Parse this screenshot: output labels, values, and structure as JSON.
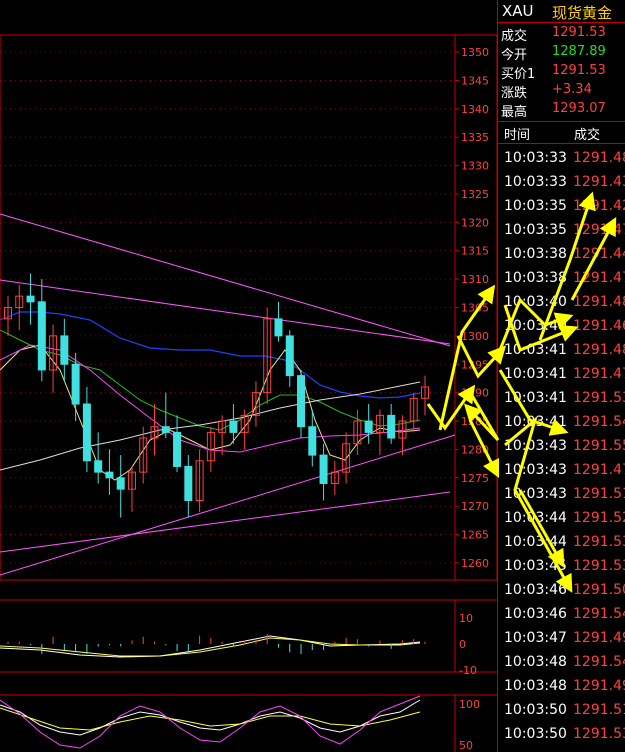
{
  "quote": {
    "symbol": "XAU",
    "name": "现货黄金",
    "rows": [
      {
        "label": "成交",
        "value": "1291.53",
        "color": "red"
      },
      {
        "label": "今开",
        "value": "1287.89",
        "color": "green"
      },
      {
        "label": "买价1",
        "value": "1291.53",
        "color": "red"
      },
      {
        "label": "涨跌",
        "value": "+3.34",
        "color": "red"
      },
      {
        "label": "最高",
        "value": "1293.07",
        "color": "red"
      }
    ]
  },
  "ticks_header": {
    "time": "时间",
    "price": "成交"
  },
  "ticks": [
    {
      "time": "10:03:33",
      "price": "1291.48"
    },
    {
      "time": "10:03:33",
      "price": "1291.43"
    },
    {
      "time": "10:03:35",
      "price": "1291.42"
    },
    {
      "time": "10:03:35",
      "price": "1291.47"
    },
    {
      "time": "10:03:38",
      "price": "1291.44"
    },
    {
      "time": "10:03:38",
      "price": "1291.47"
    },
    {
      "time": "10:03:40",
      "price": "1291.48"
    },
    {
      "time": "10:03:40",
      "price": "1291.46"
    },
    {
      "time": "10:03:41",
      "price": "1291.48"
    },
    {
      "time": "10:03:41",
      "price": "1291.47"
    },
    {
      "time": "10:03:41",
      "price": "1291.53"
    },
    {
      "time": "10:03:41",
      "price": "1291.54"
    },
    {
      "time": "10:03:43",
      "price": "1291.55"
    },
    {
      "time": "10:03:43",
      "price": "1291.47"
    },
    {
      "time": "10:03:43",
      "price": "1291.51"
    },
    {
      "time": "10:03:44",
      "price": "1291.52"
    },
    {
      "time": "10:03:44",
      "price": "1291.53"
    },
    {
      "time": "10:03:45",
      "price": "1291.53"
    },
    {
      "time": "10:03:46",
      "price": "1291.50"
    },
    {
      "time": "10:03:46",
      "price": "1291.54"
    },
    {
      "time": "10:03:47",
      "price": "1291.49"
    },
    {
      "time": "10:03:48",
      "price": "1291.54"
    },
    {
      "time": "10:03:48",
      "price": "1291.49"
    },
    {
      "time": "10:03:50",
      "price": "1291.51"
    },
    {
      "time": "10:03:50",
      "price": "1291.53"
    }
  ],
  "price_axis": {
    "labels": [
      "1350",
      "1345",
      "1340",
      "1335",
      "1330",
      "1325",
      "1320",
      "1315",
      "1310",
      "1305",
      "1300",
      "1295",
      "1290",
      "1285",
      "1280",
      "1275",
      "1270",
      "1265",
      "1260"
    ],
    "ylim": [
      1257,
      1353
    ]
  },
  "macd_axis": {
    "labels": [
      "10",
      "0",
      "-10"
    ]
  },
  "kdj_axis": {
    "labels": [
      "100",
      "50"
    ]
  },
  "candles": [
    {
      "o": 1303,
      "h": 1307,
      "l": 1300,
      "c": 1305
    },
    {
      "o": 1305,
      "h": 1309,
      "l": 1301,
      "c": 1307
    },
    {
      "o": 1307,
      "h": 1311,
      "l": 1302,
      "c": 1306
    },
    {
      "o": 1306,
      "h": 1310,
      "l": 1292,
      "c": 1294
    },
    {
      "o": 1294,
      "h": 1302,
      "l": 1290,
      "c": 1300
    },
    {
      "o": 1300,
      "h": 1303,
      "l": 1292,
      "c": 1295
    },
    {
      "o": 1295,
      "h": 1297,
      "l": 1285,
      "c": 1288
    },
    {
      "o": 1288,
      "h": 1291,
      "l": 1276,
      "c": 1278
    },
    {
      "o": 1278,
      "h": 1283,
      "l": 1274,
      "c": 1276
    },
    {
      "o": 1276,
      "h": 1280,
      "l": 1272,
      "c": 1275
    },
    {
      "o": 1275,
      "h": 1279,
      "l": 1268,
      "c": 1273
    },
    {
      "o": 1273,
      "h": 1277,
      "l": 1269,
      "c": 1276
    },
    {
      "o": 1276,
      "h": 1284,
      "l": 1274,
      "c": 1282
    },
    {
      "o": 1282,
      "h": 1288,
      "l": 1279,
      "c": 1284
    },
    {
      "o": 1284,
      "h": 1290,
      "l": 1282,
      "c": 1283
    },
    {
      "o": 1283,
      "h": 1286,
      "l": 1276,
      "c": 1277
    },
    {
      "o": 1277,
      "h": 1279,
      "l": 1268,
      "c": 1271
    },
    {
      "o": 1271,
      "h": 1280,
      "l": 1269,
      "c": 1278
    },
    {
      "o": 1278,
      "h": 1284,
      "l": 1276,
      "c": 1283
    },
    {
      "o": 1283,
      "h": 1286,
      "l": 1279,
      "c": 1285
    },
    {
      "o": 1285,
      "h": 1288,
      "l": 1281,
      "c": 1283
    },
    {
      "o": 1283,
      "h": 1287,
      "l": 1280,
      "c": 1286
    },
    {
      "o": 1286,
      "h": 1292,
      "l": 1284,
      "c": 1290
    },
    {
      "o": 1290,
      "h": 1305,
      "l": 1288,
      "c": 1303
    },
    {
      "o": 1303,
      "h": 1306,
      "l": 1299,
      "c": 1300
    },
    {
      "o": 1300,
      "h": 1301,
      "l": 1291,
      "c": 1293
    },
    {
      "o": 1293,
      "h": 1294,
      "l": 1282,
      "c": 1284
    },
    {
      "o": 1284,
      "h": 1287,
      "l": 1277,
      "c": 1279
    },
    {
      "o": 1279,
      "h": 1281,
      "l": 1271,
      "c": 1274
    },
    {
      "o": 1274,
      "h": 1278,
      "l": 1272,
      "c": 1276
    },
    {
      "o": 1276,
      "h": 1283,
      "l": 1274,
      "c": 1281
    },
    {
      "o": 1281,
      "h": 1287,
      "l": 1279,
      "c": 1285
    },
    {
      "o": 1285,
      "h": 1288,
      "l": 1281,
      "c": 1283
    },
    {
      "o": 1283,
      "h": 1287,
      "l": 1279,
      "c": 1286
    },
    {
      "o": 1286,
      "h": 1288,
      "l": 1281,
      "c": 1282
    },
    {
      "o": 1282,
      "h": 1286,
      "l": 1279,
      "c": 1285
    },
    {
      "o": 1285,
      "h": 1290,
      "l": 1283,
      "c": 1289
    },
    {
      "o": 1289,
      "h": 1293,
      "l": 1286,
      "c": 1291
    }
  ],
  "colors": {
    "up": "#ff4040",
    "down": "#40e0e0",
    "grid": "#aa0000",
    "axis": "#cc0000",
    "arrow": "#ffff00"
  }
}
